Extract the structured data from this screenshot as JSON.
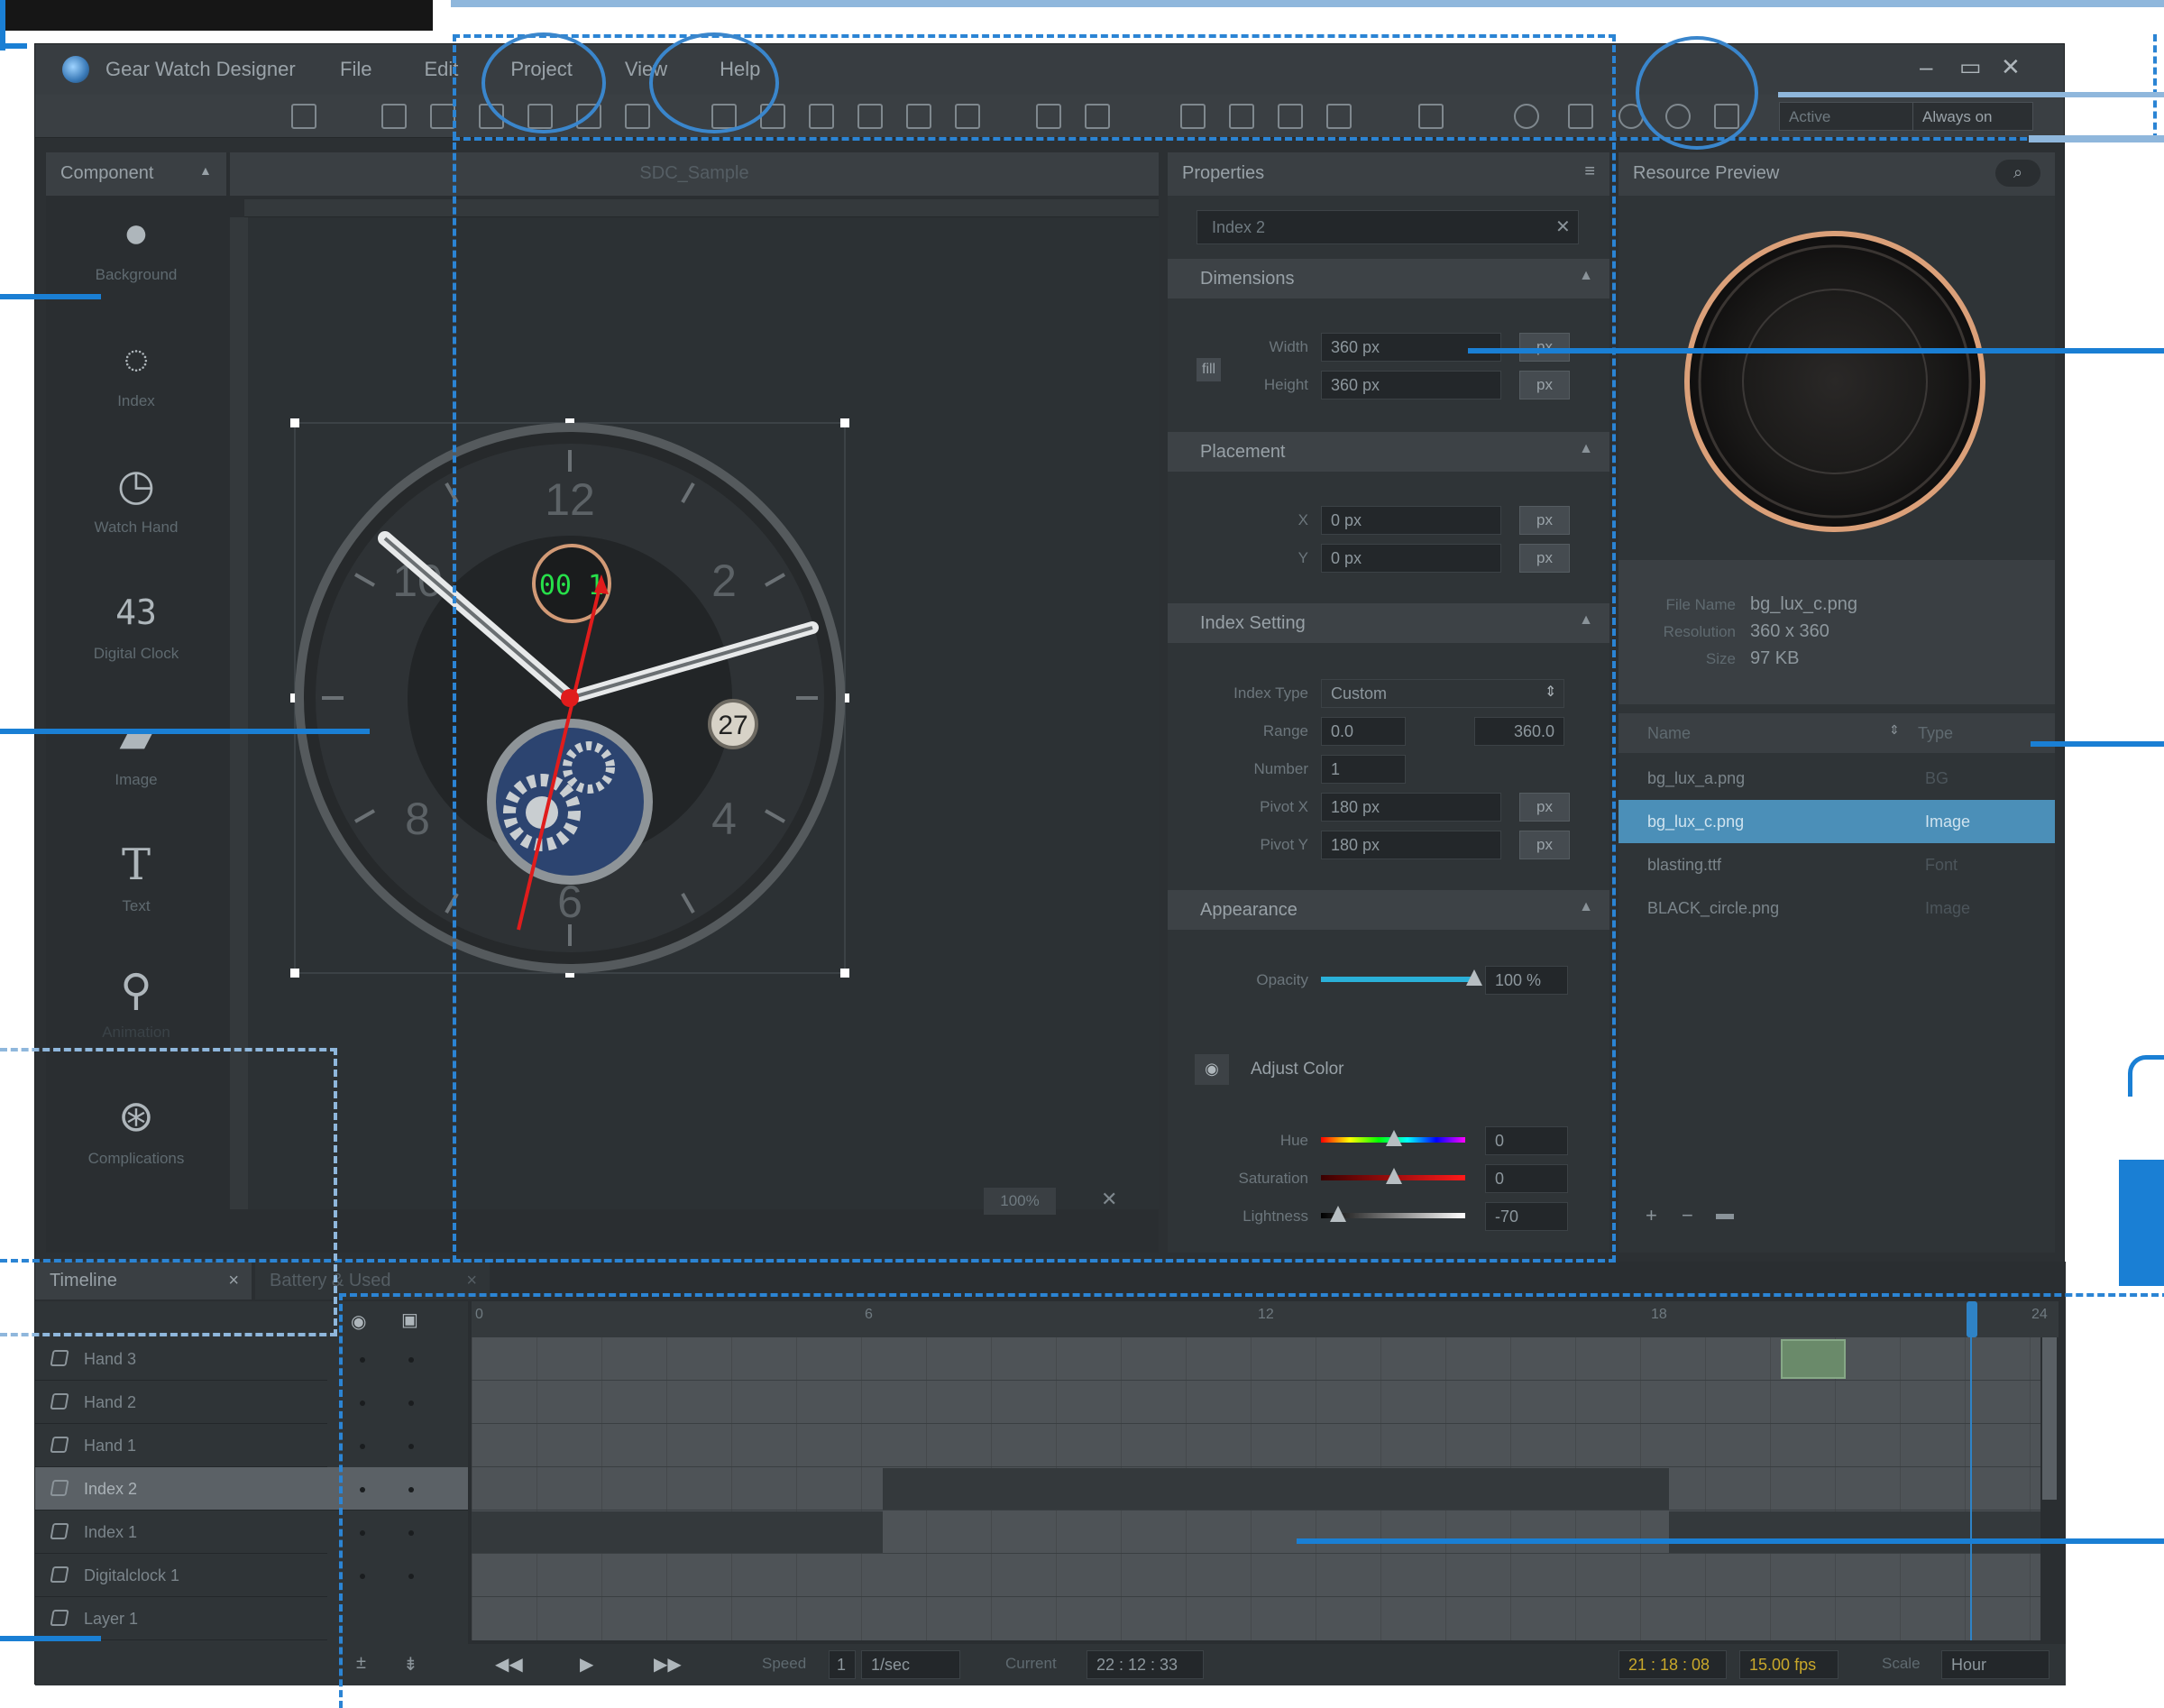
{
  "app": {
    "title": "Gear Watch Designer"
  },
  "menu": [
    "File",
    "Edit",
    "Project",
    "View",
    "Help"
  ],
  "toolbar": {
    "mode_label": "Active",
    "mode_value": "Always on"
  },
  "component_panel": {
    "title": "Component",
    "canvas_tab": "SDC_Sample",
    "items": [
      "Background",
      "Index",
      "Watch Hand",
      "Digital Clock",
      "Image",
      "Text",
      "Animation",
      "Complications"
    ],
    "zoom": "100%"
  },
  "watch": {
    "numerals": [
      "12",
      "2",
      "4",
      "6",
      "8",
      "10"
    ],
    "digital": "00 1",
    "date": "27"
  },
  "properties": {
    "title": "Properties",
    "search_value": "Index 2",
    "dimensions": {
      "title": "Dimensions",
      "width_label": "Width",
      "width_value": "360 px",
      "height_label": "Height",
      "height_value": "360 px",
      "unit": "px",
      "link_label": "fill"
    },
    "placement": {
      "title": "Placement",
      "x_label": "X",
      "x_value": "0 px",
      "y_label": "Y",
      "y_value": "0 px",
      "unit": "px"
    },
    "index_setting": {
      "title": "Index Setting",
      "type_label": "Index Type",
      "type_value": "Custom",
      "range_label": "Range",
      "range_from": "0.0",
      "range_to": "360.0",
      "number_label": "Number",
      "number_value": "1",
      "pivotx_label": "Pivot X",
      "pivotx_value": "180 px",
      "pivoty_label": "Pivot Y",
      "pivoty_value": "180 px",
      "unit": "px"
    },
    "appearance": {
      "title": "Appearance",
      "opacity_label": "Opacity",
      "opacity_value": "100 %",
      "opacity_level": 1.0,
      "adjust_color": "Adjust Color",
      "hue_label": "Hue",
      "hue_value": "0",
      "sat_label": "Saturation",
      "sat_value": "0",
      "light_label": "Lightness",
      "light_value": "-70"
    }
  },
  "resource": {
    "title": "Resource Preview",
    "file_name_label": "File Name",
    "file_name": "bg_lux_c.png",
    "resolution_label": "Resolution",
    "resolution": "360 x 360",
    "size_label": "Size",
    "size": "97 KB",
    "col_name": "Name",
    "col_type": "Type",
    "rows": [
      {
        "name": "bg_lux_a.png",
        "type": "BG"
      },
      {
        "name": "bg_lux_c.png",
        "type": "Image"
      },
      {
        "name": "blasting.ttf",
        "type": "Font"
      },
      {
        "name": "BLACK_circle.png",
        "type": "Image"
      }
    ]
  },
  "timeline": {
    "tab1": "Timeline",
    "tab2": "Battery & Used",
    "ticks": [
      "0",
      "6",
      "12",
      "18",
      "24"
    ],
    "layers": [
      "Hand 3",
      "Hand 2",
      "Hand 1",
      "Index 2",
      "Index 1",
      "Digitalclock 1",
      "Layer 1"
    ],
    "speed_label": "Speed",
    "speed_value": "1",
    "speed_unit": "1/sec",
    "current_label": "Current",
    "current_value": "22 : 12 : 33",
    "clock_value": "21 : 18 : 08",
    "fps_value": "15.00",
    "fps_label": "fps",
    "scale_label": "Scale",
    "scale_value": "Hour"
  },
  "colors": {
    "accent": "#2b84d4",
    "selection": "#4b8fb8",
    "hand": "#e01c1c"
  }
}
